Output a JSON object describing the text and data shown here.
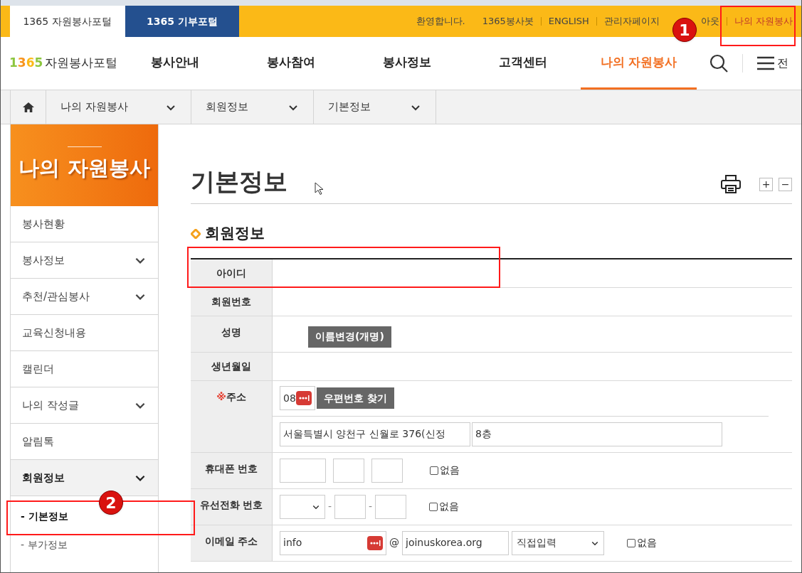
{
  "top_tabs": [
    {
      "label": "1365 자원봉사포털",
      "selected": true
    },
    {
      "label": "1365 기부포털",
      "selected": false
    }
  ],
  "top_links": [
    {
      "label": "환영합니다.",
      "selected": false
    },
    {
      "label": "1365봉사봇",
      "selected": false
    },
    {
      "label": "ENGLISH",
      "selected": false
    },
    {
      "label": "관리자페이지",
      "selected": false
    },
    {
      "label": "아웃",
      "selected": false
    },
    {
      "label": "나의 자원봉사",
      "selected": true
    }
  ],
  "logo": {
    "number": "1365",
    "text": "자원봉사포털"
  },
  "nav": [
    {
      "label": "봉사안내",
      "selected": false
    },
    {
      "label": "봉사참여",
      "selected": false
    },
    {
      "label": "봉사정보",
      "selected": false
    },
    {
      "label": "고객센터",
      "selected": false
    },
    {
      "label": "나의 자원봉사",
      "selected": true
    }
  ],
  "menu_label": "전",
  "breadcrumb": [
    "나의 자원봉사",
    "회원정보",
    "기본정보"
  ],
  "sidebar": {
    "title": "나의 자원봉사",
    "items": [
      {
        "label": "봉사현황",
        "expandable": false,
        "expanded": false
      },
      {
        "label": "봉사정보",
        "expandable": true,
        "expanded": false
      },
      {
        "label": "추천/관심봉사",
        "expandable": true,
        "expanded": false
      },
      {
        "label": "교육신청내용",
        "expandable": false,
        "expanded": false
      },
      {
        "label": "캘린더",
        "expandable": false,
        "expanded": false
      },
      {
        "label": "나의 작성글",
        "expandable": true,
        "expanded": false
      },
      {
        "label": "알림톡",
        "expandable": false,
        "expanded": false
      },
      {
        "label": "회원정보",
        "expandable": true,
        "expanded": true,
        "children": [
          {
            "label": "- 기본정보",
            "selected": true
          },
          {
            "label": "- 부가정보",
            "selected": false
          }
        ]
      }
    ]
  },
  "page_title": "기본정보",
  "zoom_controls": [
    "+",
    "−"
  ],
  "section_title": "회원정보",
  "form_rows": [
    {
      "kind": "plain",
      "label": "아이디"
    },
    {
      "kind": "plain",
      "label": "회원번호"
    },
    {
      "kind": "name",
      "label": "성명",
      "button": "이름변경(개명)"
    },
    {
      "kind": "plain",
      "label": "생년월일"
    },
    {
      "kind": "address",
      "label": "주소",
      "mark": "※",
      "zip": "08",
      "button": "우편번호 찾기",
      "address": "서울특별시 양천구 신월로 376(신정",
      "detail": "8층"
    },
    {
      "kind": "phone",
      "label": "휴대폰 번호",
      "none_label": "없음",
      "none_checked": false
    },
    {
      "kind": "landline",
      "label": "유선전화 번호",
      "separators": [
        "-",
        "-"
      ],
      "none_label": "없음",
      "none_checked": false
    },
    {
      "kind": "email",
      "label": "이메일 주소",
      "user": "info",
      "at": "@",
      "domain": "joinuskorea.org",
      "domain_select": "직접입력",
      "none_label": "없음",
      "none_checked": false
    }
  ],
  "annotations": [
    {
      "kind": "numbered",
      "number": "1"
    },
    {
      "kind": "numbered",
      "number": "2"
    },
    {
      "kind": "plain"
    }
  ]
}
